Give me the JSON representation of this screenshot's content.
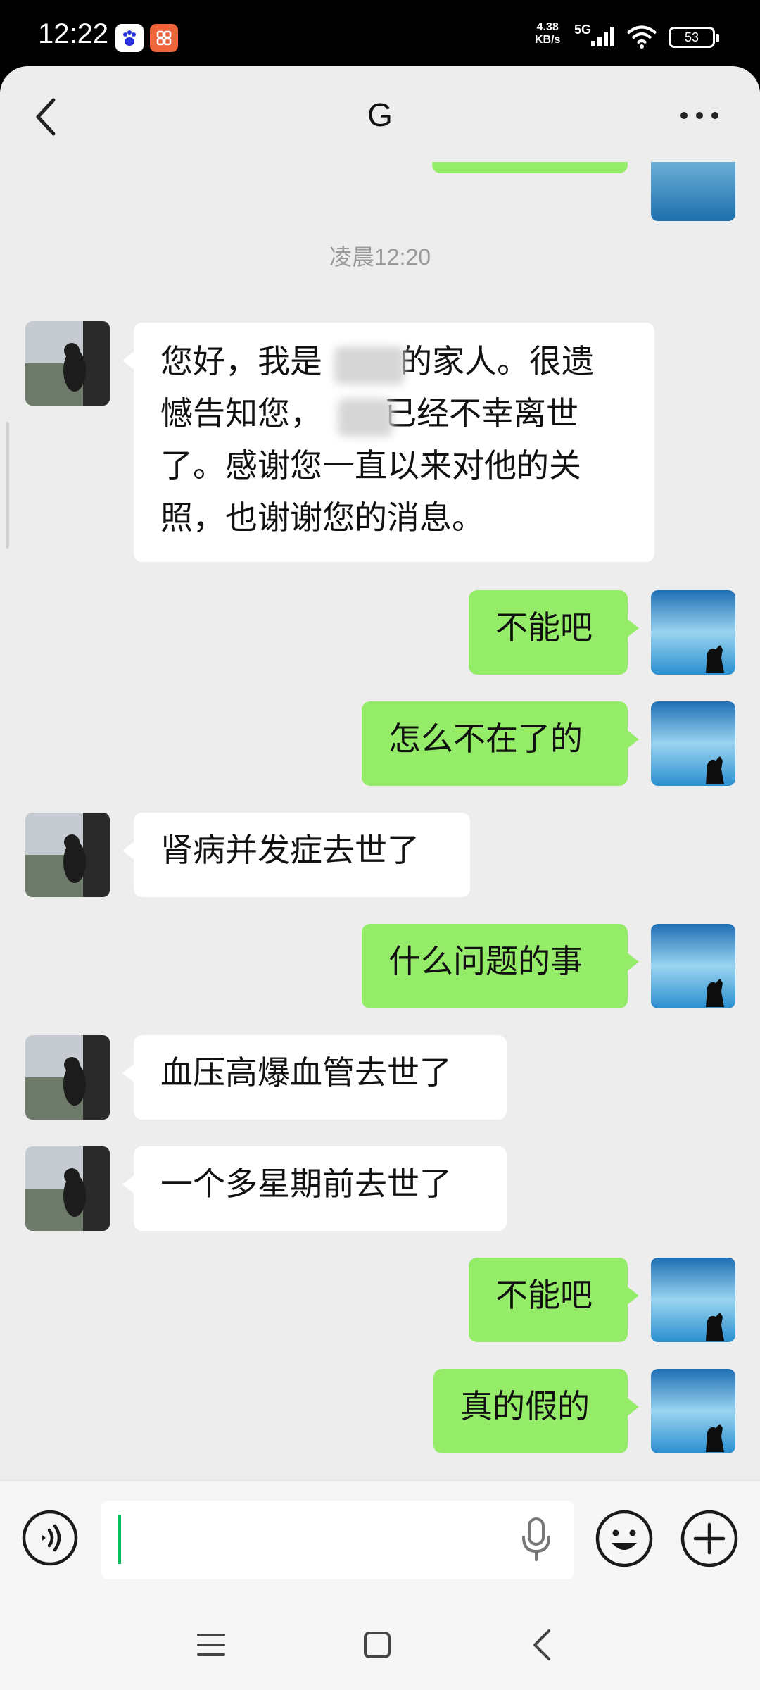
{
  "status_bar": {
    "time": "12:22",
    "net_speed_value": "4.38",
    "net_speed_unit": "KB/s",
    "network": "5G",
    "battery": "53",
    "app_icons": [
      "baidu-icon",
      "taobao-icon"
    ]
  },
  "header": {
    "back_icon": "chevron-left-icon",
    "title": "G",
    "more_icon": "more-dots-icon"
  },
  "chat": {
    "timestamp": "凌晨12:20",
    "messages": [
      {
        "side": "received",
        "text": "您好，我是          的家人。很遗憾告知您，      已经不幸离世了。感谢您一直以来对他的关照，也谢谢您的消息。",
        "has_redaction": true
      },
      {
        "side": "sent",
        "text": "不能吧"
      },
      {
        "side": "sent",
        "text": "怎么不在了的"
      },
      {
        "side": "received",
        "text": "肾病并发症去世了"
      },
      {
        "side": "sent",
        "text": "什么问题的事"
      },
      {
        "side": "received",
        "text": "血压高爆血管去世了"
      },
      {
        "side": "received",
        "text": "一个多星期前去世了"
      },
      {
        "side": "sent",
        "text": "不能吧"
      },
      {
        "side": "sent",
        "text": "真的假的"
      }
    ],
    "multi_line": {
      "line1a": "您好，我是",
      "line1b": "的家人。很遗",
      "line2a": "憾告知您，",
      "line2b": "已经不幸离世",
      "line3": "了。感谢您一直以来对他的关",
      "line4": "照，也谢谢您的消息。"
    }
  },
  "input_bar": {
    "voice_icon": "voice-mode-icon",
    "input_value": "",
    "mic_icon": "microphone-icon",
    "emoji_icon": "emoji-icon",
    "plus_icon": "plus-circle-icon"
  },
  "colors": {
    "sent_bubble": "#95ec69",
    "received_bubble": "#ffffff",
    "background": "#ededed",
    "caret": "#07c160"
  }
}
